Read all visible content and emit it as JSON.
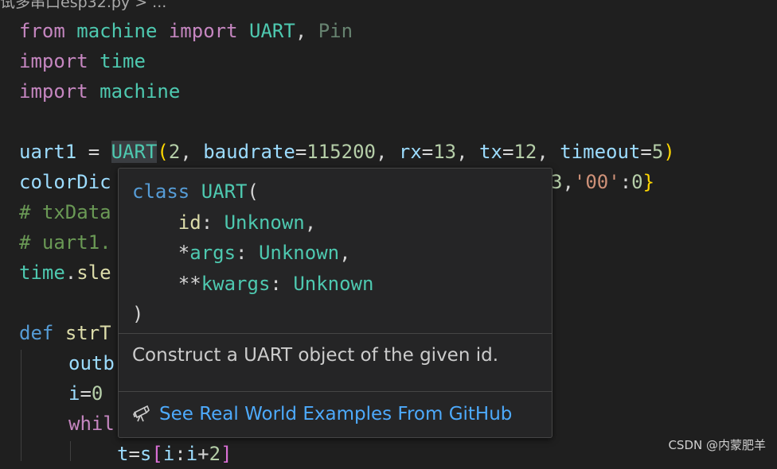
{
  "breadcrumb": "试多串口esp32.py > ...",
  "code": {
    "l1": {
      "from": "from",
      "machine": "machine",
      "import": "import",
      "UART": "UART",
      "comma": ",",
      "Pin": "Pin"
    },
    "l2": {
      "import": "import",
      "time": "time"
    },
    "l3": {
      "import": "import",
      "machine": "machine"
    },
    "l5": {
      "var": "uart1",
      "eq": " = ",
      "cls": "UART",
      "open": "(",
      "arg1": "2",
      "c1": ", ",
      "k1": "baudrate",
      "e1": "=",
      "v1": "115200",
      "c2": ", ",
      "k2": "rx",
      "e2": "=",
      "v2": "13",
      "c3": ", ",
      "k3": "tx",
      "e3": "=",
      "v3": "12",
      "c4": ", ",
      "k4": "timeout",
      "e4": "=",
      "v4": "5",
      "close": ")"
    },
    "l6": {
      "var": "colorDic",
      "tail_num": "3",
      "tail_comma": ",",
      "tail_str": "'00'",
      "tail_colon": ":",
      "tail_zero": "0",
      "tail_brace": "}"
    },
    "l7": {
      "text": "# txData"
    },
    "l8": {
      "text": "# uart1."
    },
    "l9": {
      "obj": "time",
      "dot": ".",
      "fn": "sle"
    },
    "l11": {
      "def": "def",
      "fn": "strT"
    },
    "l12": {
      "var": "outb"
    },
    "l13": {
      "var": "i",
      "eq": "=",
      "num": "0"
    },
    "l14": {
      "kw": "whil"
    },
    "l15": {
      "var": "t",
      "eq": "=",
      "s": "s",
      "open": "[",
      "i1": "i",
      "colon": ":",
      "i2": "i",
      "plus": "+",
      "n": "2",
      "close": "]"
    }
  },
  "hover": {
    "sig_class": "class",
    "sig_name": "UART",
    "sig_open": "(",
    "p1_name": "id",
    "p1_sep": ": ",
    "p1_type": "Unknown",
    "p1_comma": ",",
    "p2_star": "*",
    "p2_name": "args",
    "p2_sep": ": ",
    "p2_type": "Unknown",
    "p2_comma": ",",
    "p3_star": "**",
    "p3_name": "kwargs",
    "p3_sep": ": ",
    "p3_type": "Unknown",
    "sig_close": ")",
    "doc": "Construct a UART object of the given id.",
    "link": "See Real World Examples From GitHub"
  },
  "watermark": "CSDN @内蒙肥羊",
  "colors": {
    "background": "#1f1f1f",
    "keyword": "#c586c0",
    "module": "#4ec9b0",
    "link": "#4daafc"
  }
}
